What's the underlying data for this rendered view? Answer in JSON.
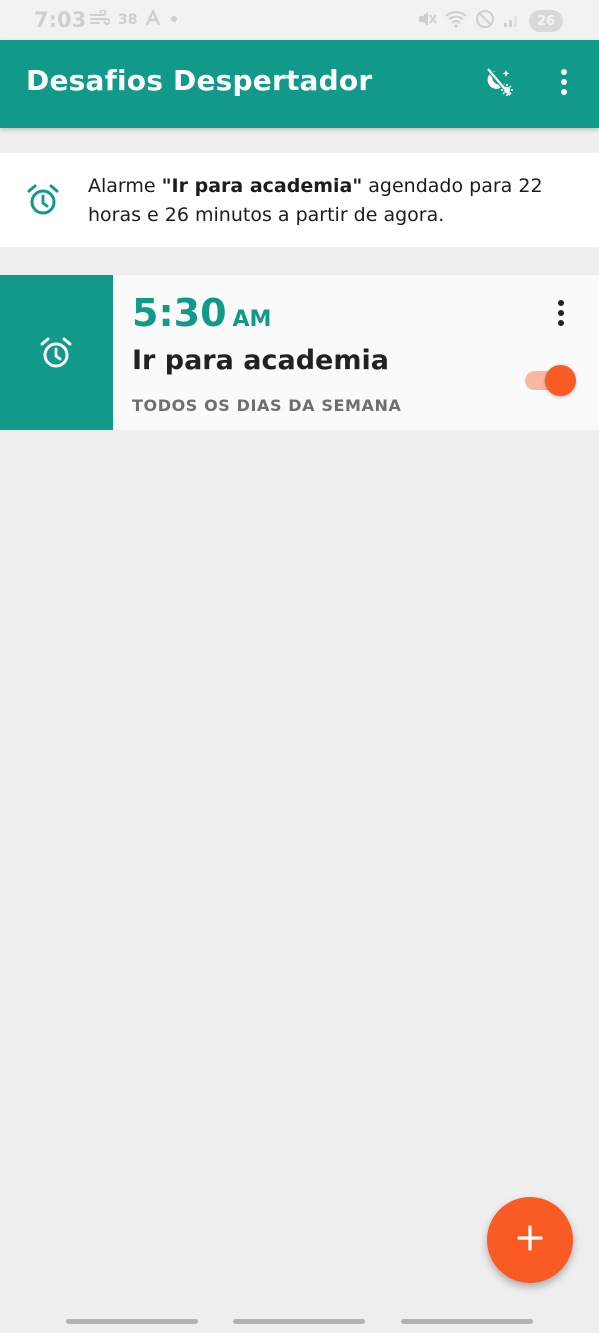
{
  "status_bar": {
    "time": "7:03",
    "notif_count": "38",
    "battery": "26",
    "icons": [
      "wind-icon",
      "a-icon",
      "dot-icon",
      "mute-icon",
      "wifi-icon",
      "dnd-icon",
      "signal-icon"
    ]
  },
  "app_bar": {
    "title": "Desafios Despertador",
    "actions": [
      "theme-toggle-icon",
      "more-vertical-icon"
    ]
  },
  "notice": {
    "prefix": "Alarme ",
    "alarm_name": "\"Ir para academia\"",
    "suffix": " agendado para 22 horas e 26 minutos a partir de agora.",
    "icon": "alarm-clock-icon"
  },
  "alarms": [
    {
      "time": "5:30",
      "ampm": "AM",
      "label": "Ir para academia",
      "days": "TODOS OS DIAS DA SEMANA",
      "enabled": true
    }
  ],
  "fab": {
    "icon": "plus-icon"
  },
  "colors": {
    "primary": "#11998a",
    "accent": "#fa5a24",
    "background": "#eeeeee"
  }
}
